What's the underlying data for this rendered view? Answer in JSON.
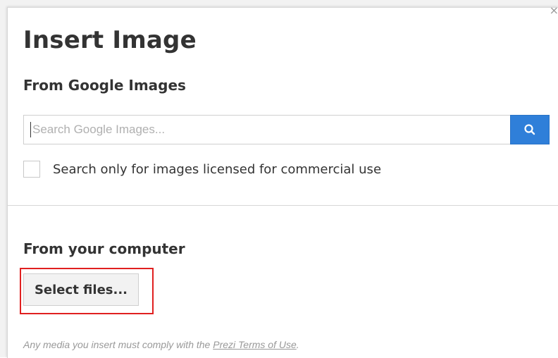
{
  "dialog": {
    "title": "Insert Image",
    "close_glyph": "×"
  },
  "google_section": {
    "heading": "From Google Images",
    "search": {
      "placeholder": "Search Google Images...",
      "value": "",
      "button_icon": "search-icon"
    },
    "checkbox": {
      "label": "Search only for images licensed for commercial use",
      "checked": false
    }
  },
  "computer_section": {
    "heading": "From your computer",
    "select_files_label": "Select files..."
  },
  "footer": {
    "disclaimer_prefix": "Any media you insert must comply with the ",
    "terms_link": "Prezi Terms of Use",
    "disclaimer_suffix": "."
  },
  "colors": {
    "accent": "#2f7fd9",
    "highlight": "#e02020"
  }
}
